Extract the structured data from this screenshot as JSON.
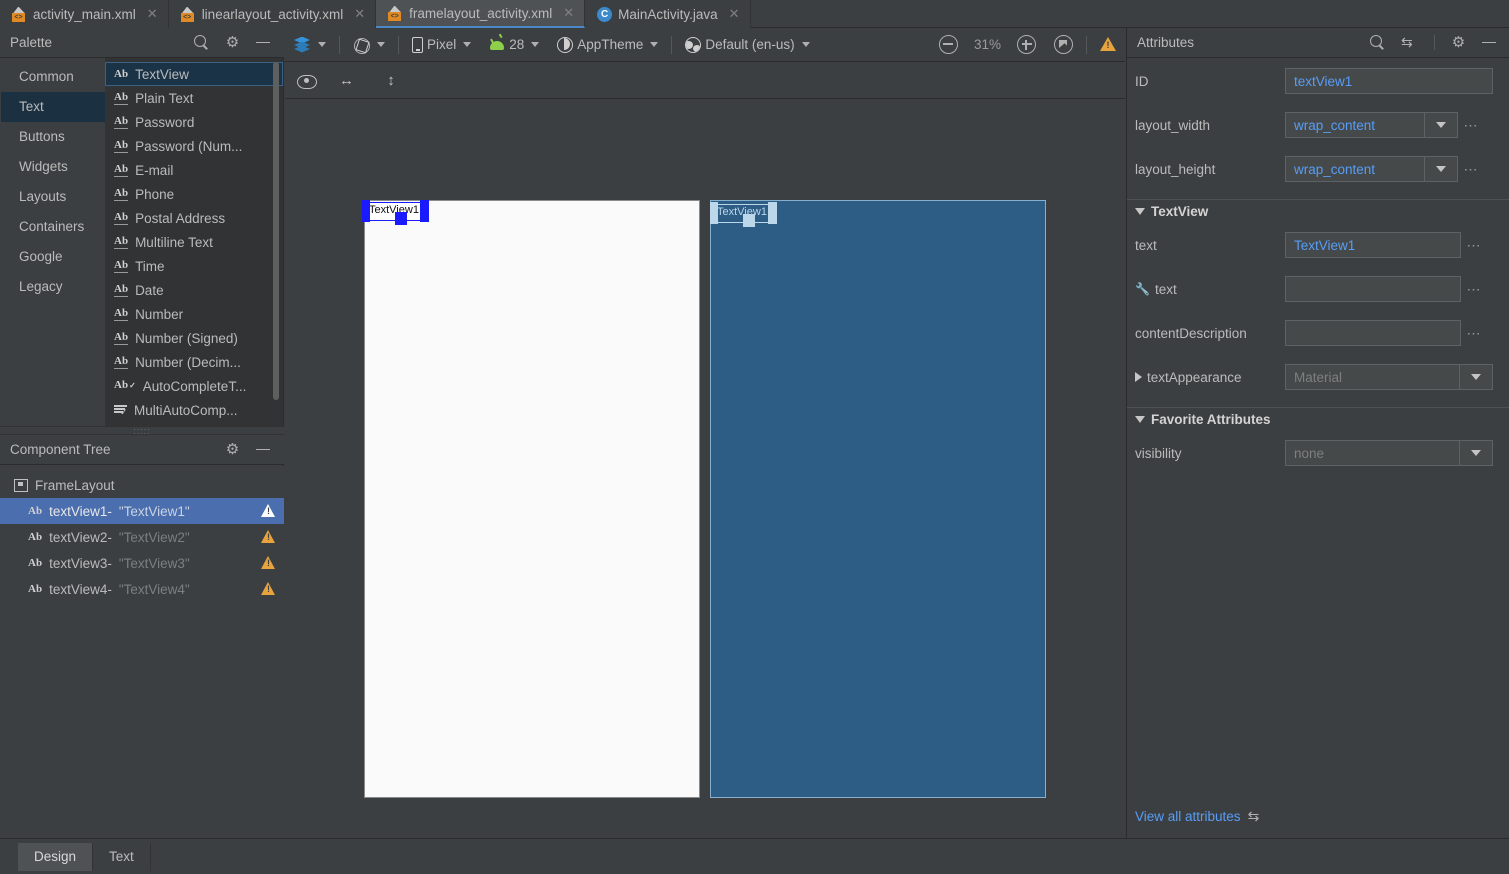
{
  "tabs": [
    {
      "label": "activity_main.xml",
      "icon": "xml-layout-icon",
      "active": false
    },
    {
      "label": "linearlayout_activity.xml",
      "icon": "xml-layout-icon",
      "active": false
    },
    {
      "label": "framelayout_activity.xml",
      "icon": "xml-layout-icon",
      "active": true
    },
    {
      "label": "MainActivity.java",
      "icon": "java-class-icon",
      "active": false
    }
  ],
  "palette": {
    "title": "Palette",
    "categories": [
      {
        "label": "Common",
        "selected": false
      },
      {
        "label": "Text",
        "selected": true
      },
      {
        "label": "Buttons",
        "selected": false
      },
      {
        "label": "Widgets",
        "selected": false
      },
      {
        "label": "Layouts",
        "selected": false
      },
      {
        "label": "Containers",
        "selected": false
      },
      {
        "label": "Google",
        "selected": false
      },
      {
        "label": "Legacy",
        "selected": false
      }
    ],
    "items": [
      {
        "label": "TextView",
        "icon": "ab-icon",
        "selected": true
      },
      {
        "label": "Plain Text",
        "icon": "ab-icon",
        "selected": false
      },
      {
        "label": "Password",
        "icon": "ab-icon",
        "selected": false
      },
      {
        "label": "Password (Num...",
        "icon": "ab-icon",
        "selected": false
      },
      {
        "label": "E-mail",
        "icon": "ab-icon",
        "selected": false
      },
      {
        "label": "Phone",
        "icon": "ab-icon",
        "selected": false
      },
      {
        "label": "Postal Address",
        "icon": "ab-icon",
        "selected": false
      },
      {
        "label": "Multiline Text",
        "icon": "ab-icon",
        "selected": false
      },
      {
        "label": "Time",
        "icon": "ab-icon",
        "selected": false
      },
      {
        "label": "Date",
        "icon": "ab-icon",
        "selected": false
      },
      {
        "label": "Number",
        "icon": "ab-icon",
        "selected": false
      },
      {
        "label": "Number (Signed)",
        "icon": "ab-icon",
        "selected": false
      },
      {
        "label": "Number (Decim...",
        "icon": "ab-icon",
        "selected": false
      },
      {
        "label": "AutoCompleteT...",
        "icon": "ab-check-icon",
        "selected": false
      },
      {
        "label": "MultiAutoComp...",
        "icon": "ab-lines-check-icon",
        "selected": false
      }
    ]
  },
  "component_tree": {
    "title": "Component Tree",
    "nodes": [
      {
        "type": "FrameLayout",
        "label": "FrameLayout",
        "value": "",
        "icon": "framelayout-icon",
        "selected": false,
        "warning": false
      },
      {
        "type": "TextView",
        "label": "textView1-",
        "value": "\"TextView1\"",
        "icon": "ab-icon",
        "selected": true,
        "warning": true
      },
      {
        "type": "TextView",
        "label": "textView2-",
        "value": "\"TextView2\"",
        "icon": "ab-icon",
        "selected": false,
        "warning": true
      },
      {
        "type": "TextView",
        "label": "textView3-",
        "value": "\"TextView3\"",
        "icon": "ab-icon",
        "selected": false,
        "warning": true
      },
      {
        "type": "TextView",
        "label": "textView4-",
        "value": "\"TextView4\"",
        "icon": "ab-icon",
        "selected": false,
        "warning": true
      }
    ]
  },
  "design_toolbar": {
    "design_mode": "Design",
    "orientation": "Portrait",
    "device": "Pixel",
    "api_level": "28",
    "theme": "AppTheme",
    "locale": "Default (en-us)",
    "zoom_level": "31%"
  },
  "canvas": {
    "design_surface_background": "#3c3f41",
    "previews": [
      {
        "name": "design-preview",
        "background": "#fafafa",
        "widget_text": "TextView1",
        "selected": true,
        "selection_color": "#1a1aff"
      },
      {
        "name": "blueprint-preview",
        "background": "#2d5c84",
        "widget_text": "TextView1",
        "selected": true,
        "selection_color": "#bcd6ea"
      }
    ]
  },
  "attributes": {
    "title": "Attributes",
    "rows": [
      {
        "label": "ID",
        "value": "textView1",
        "control": "text",
        "dots": false,
        "dropdown": false,
        "placeholder": ""
      },
      {
        "label": "layout_width",
        "value": "wrap_content",
        "control": "combo",
        "dots": true,
        "dropdown": true,
        "placeholder": ""
      },
      {
        "label": "layout_height",
        "value": "wrap_content",
        "control": "combo",
        "dots": true,
        "dropdown": true,
        "placeholder": ""
      }
    ],
    "section_textview": {
      "title": "TextView",
      "expanded": true,
      "rows": [
        {
          "label": "text",
          "value": "TextView1",
          "control": "text",
          "dots": true,
          "icon": "",
          "placeholder": ""
        },
        {
          "label": "text",
          "value": "",
          "control": "text",
          "dots": true,
          "icon": "wrench-icon",
          "placeholder": ""
        },
        {
          "label": "contentDescription",
          "value": "",
          "control": "text",
          "dots": true,
          "icon": "",
          "placeholder": ""
        },
        {
          "label": "textAppearance",
          "value": "Material",
          "control": "combo",
          "dots": false,
          "icon": "expand-right-icon",
          "placeholder": "Material"
        }
      ]
    },
    "section_favorites": {
      "title": "Favorite Attributes",
      "expanded": true,
      "rows": [
        {
          "label": "visibility",
          "value": "none",
          "control": "combo",
          "dots": false,
          "icon": "",
          "placeholder": "none"
        }
      ]
    },
    "view_all_label": "View all attributes"
  },
  "bottom_tabs": [
    {
      "label": "Design",
      "active": true
    },
    {
      "label": "Text",
      "active": false
    }
  ],
  "colors": {
    "panel_bg": "#3c3f41",
    "list_bg": "#313335",
    "accent_blue": "#589df6",
    "selection_blue": "#4b6eaf",
    "warning_orange": "#e8a33d",
    "blueprint_blue": "#2d5c84"
  }
}
